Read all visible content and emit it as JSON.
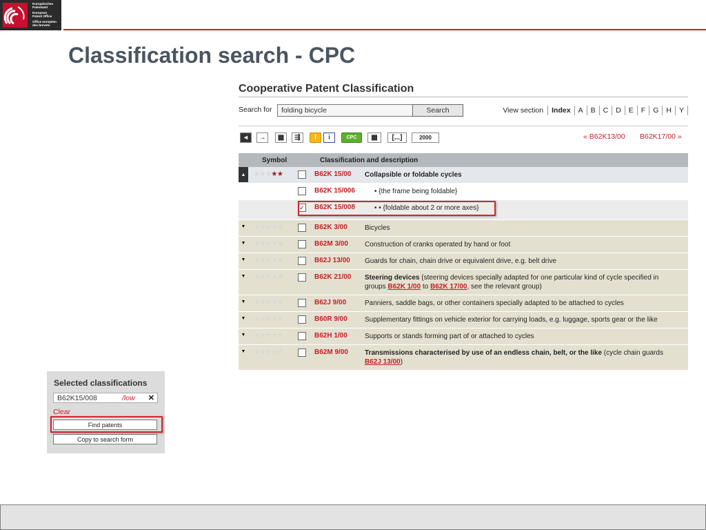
{
  "logo": {
    "lines_de": [
      "Europäisches",
      "Patentamt"
    ],
    "lines_en": [
      "European",
      "Patent Office"
    ],
    "lines_fr": [
      "Office européen",
      "des brevets"
    ]
  },
  "slide": {
    "title": "Classification search - CPC"
  },
  "cpc": {
    "title": "Cooperative Patent Classification",
    "search": {
      "label": "Search for",
      "value": "folding bicycle",
      "button": "Search"
    },
    "view_section": {
      "label": "View section",
      "items": [
        "Index",
        "A",
        "B",
        "C",
        "D",
        "E",
        "F",
        "G",
        "H",
        "Y"
      ]
    },
    "toolbar": {
      "buttons": [
        "collapse-all",
        "arrow-right",
        "grid-view",
        "tree-view",
        "warning",
        "info",
        "CPC",
        "table",
        "[...]",
        "2000"
      ],
      "cpc_label": "CPC",
      "bracket_label": "[...]",
      "year_label": "2000",
      "prev": "« B62K13/00",
      "next": "B62K17/00 »"
    },
    "table_header": {
      "symbol": "Symbol",
      "description": "Classification and description"
    },
    "rows": [
      {
        "toggle": "▲",
        "stars": 2,
        "checked": false,
        "code": "B62K 15/00",
        "desc": "Collapsible or foldable cycles",
        "level": 0
      },
      {
        "toggle": "",
        "stars": 0,
        "checked": false,
        "code": "B62K 15/006",
        "desc": "• {the frame being foldable}",
        "level": 1
      },
      {
        "toggle": "",
        "stars": 0,
        "checked": true,
        "code": "B62K 15/008",
        "desc": "• • {foldable about 2 or more axes}",
        "level": 2
      },
      {
        "toggle": "▼",
        "stars": 0,
        "checked": false,
        "code": "B62K 3/00",
        "desc": "Bicycles",
        "level": 0
      },
      {
        "toggle": "▼",
        "stars": 0,
        "checked": false,
        "code": "B62M 3/00",
        "desc": "Construction of cranks operated by hand or foot",
        "level": 0
      },
      {
        "toggle": "▼",
        "stars": 0,
        "checked": false,
        "code": "B62J 13/00",
        "desc": "Guards for chain, chain drive or equivalent drive, e.g. belt drive",
        "level": 0
      },
      {
        "toggle": "▼",
        "stars": 0,
        "checked": false,
        "code": "B62K 21/00",
        "desc_bold": "Steering devices",
        "desc_rest": " (steering devices specially adapted for one particular kind of cycle specified in groups ",
        "link1": "B62K 1/00",
        "mid": " to ",
        "link2": "B62K 17/00",
        "tail": ", see the relevant group)",
        "level": 0
      },
      {
        "toggle": "▼",
        "stars": 0,
        "checked": false,
        "code": "B62J 9/00",
        "desc": "Panniers, saddle bags, or other containers specially adapted to be attached to cycles",
        "level": 0
      },
      {
        "toggle": "▼",
        "stars": 0,
        "checked": false,
        "code": "B60R 9/00",
        "desc": "Supplementary fittings on vehicle exterior for carrying loads, e.g. luggage, sports gear or the like",
        "level": 0
      },
      {
        "toggle": "▼",
        "stars": 0,
        "checked": false,
        "code": "B62H 1/00",
        "desc": "Supports or stands forming part of or attached to cycles",
        "level": 0
      },
      {
        "toggle": "▼",
        "stars": 0,
        "checked": false,
        "code": "B62M 9/00",
        "desc_bold": "Transmissions characterised by use of an endless chain, belt, or the like",
        "desc_rest": " (cycle chain guards ",
        "link1": "B62J 13/00",
        "tail": ")",
        "level": 0
      }
    ]
  },
  "selected": {
    "title": "Selected classifications",
    "item": {
      "code": "B62K15/008",
      "low": "/low",
      "remove": "✕"
    },
    "clear": "Clear",
    "find_button": "Find patents",
    "copy_button": "Copy to search form"
  },
  "colors": {
    "accent_red": "#c41e24",
    "row_beige": "#e4e0d0",
    "header_gray": "#b3b9bd"
  }
}
